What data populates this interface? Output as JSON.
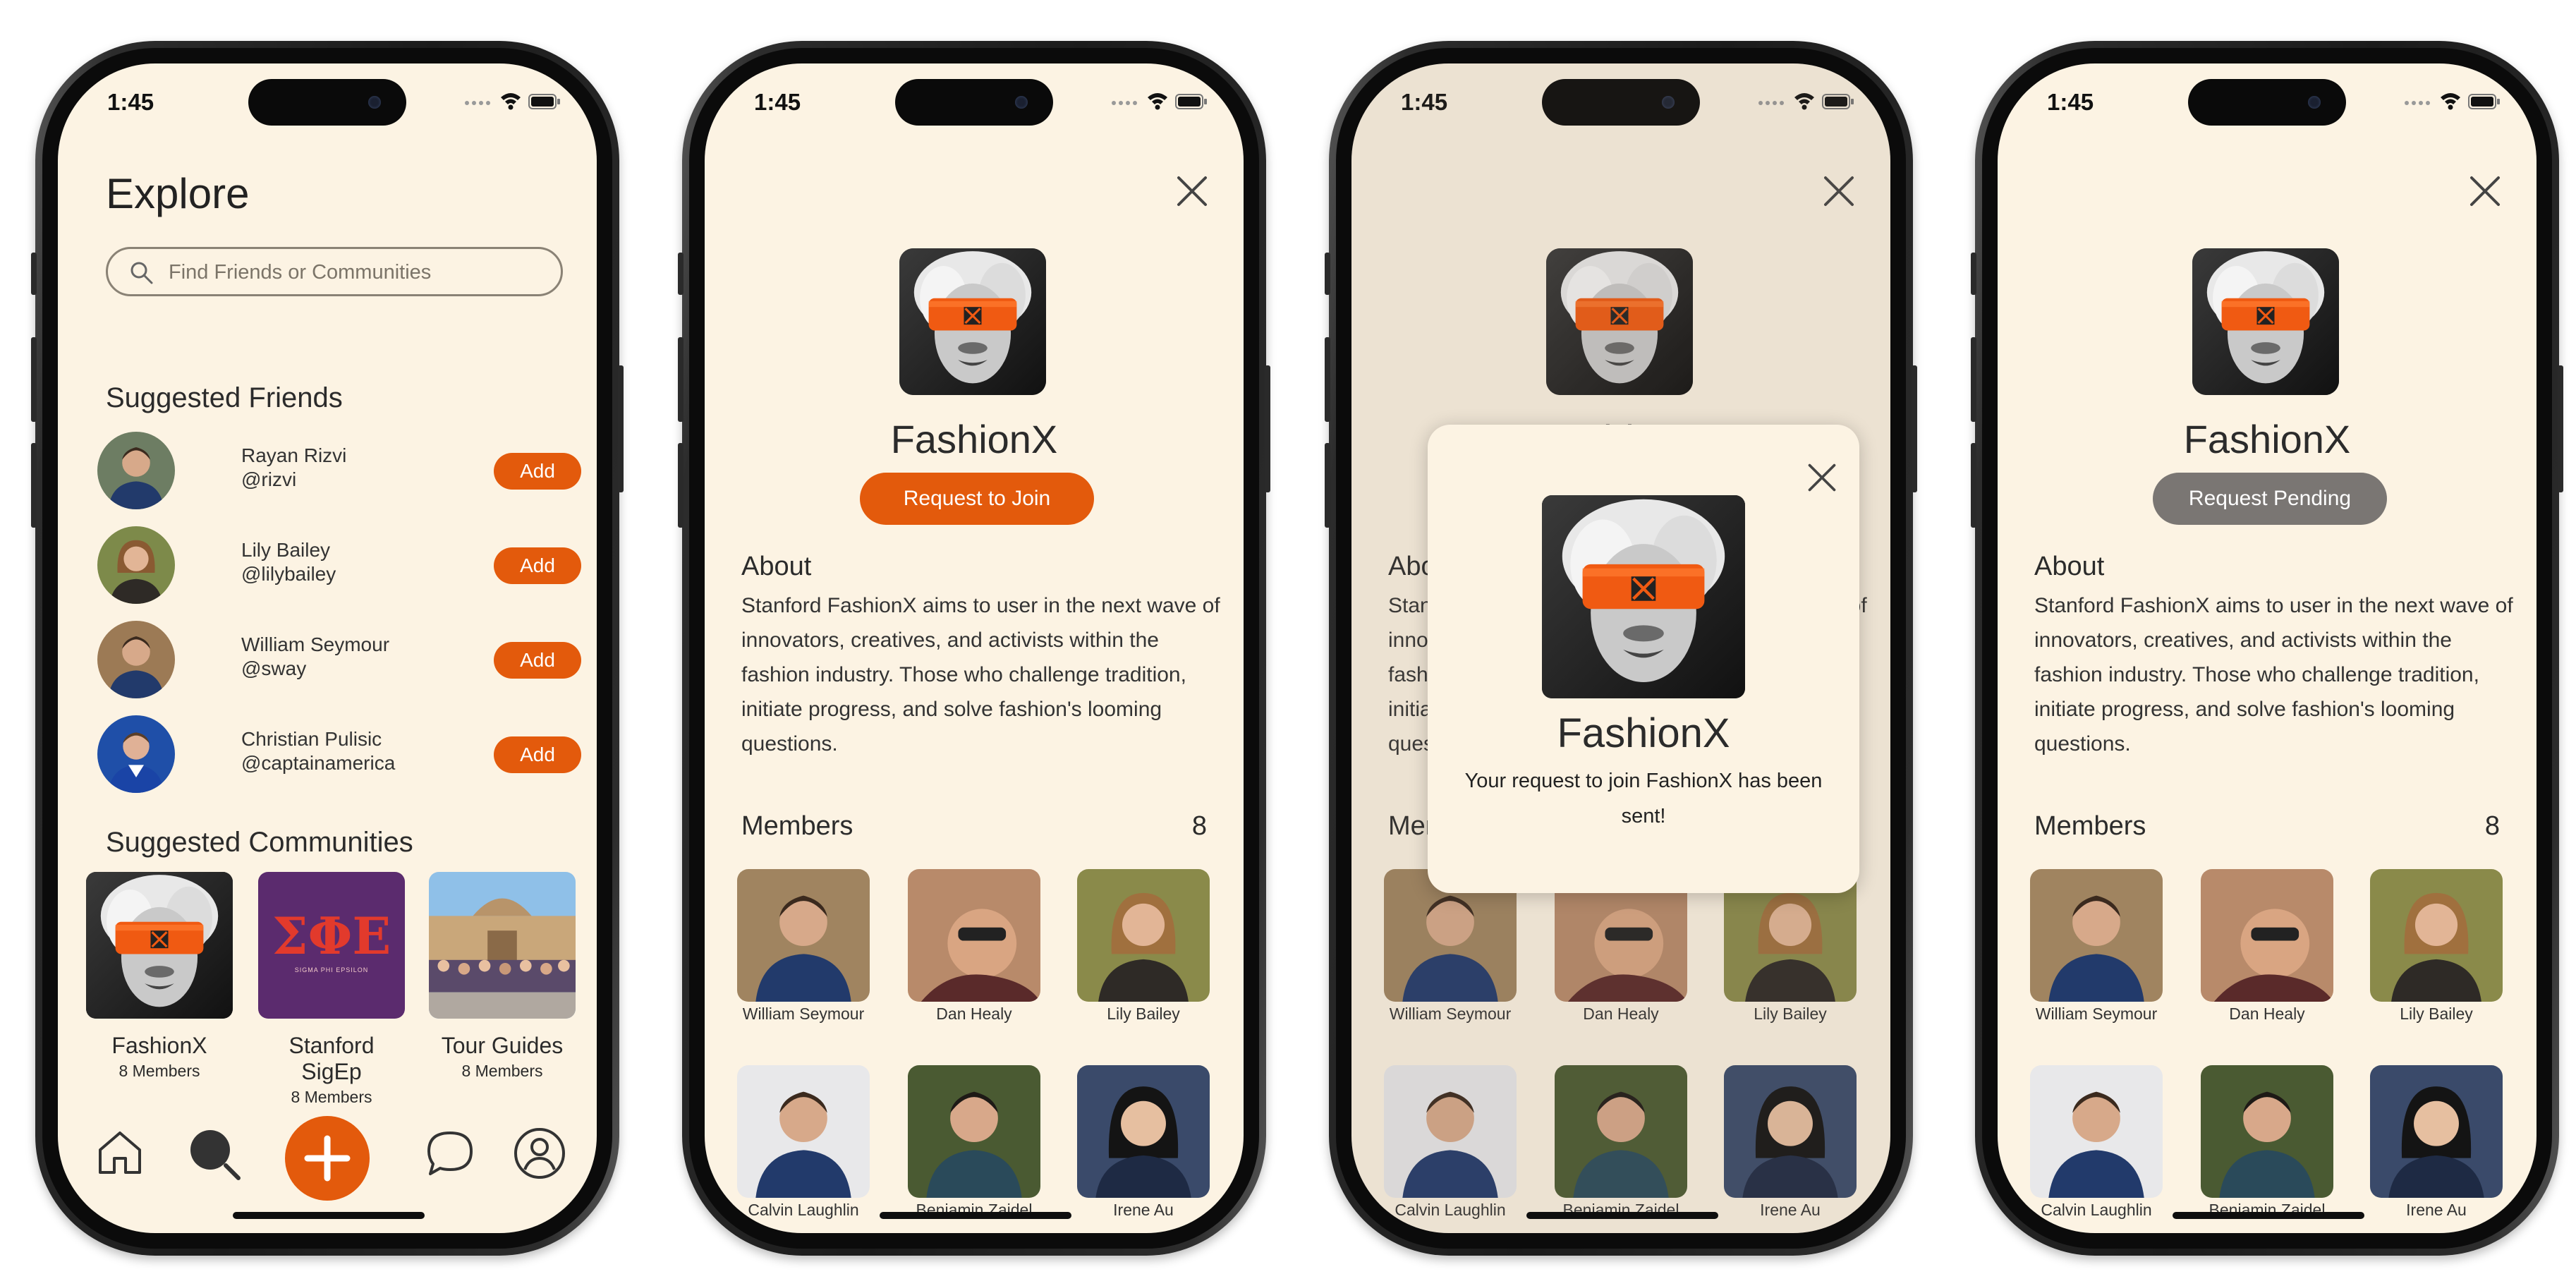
{
  "status": {
    "time": "1:45"
  },
  "explore": {
    "title": "Explore",
    "search_placeholder": "Find Friends or Communities",
    "suggested_friends_title": "Suggested Friends",
    "add_label": "Add",
    "friends": [
      {
        "name": "Rayan Rizvi",
        "handle": "@rizvi"
      },
      {
        "name": "Lily Bailey",
        "handle": "@lilybailey"
      },
      {
        "name": "William Seymour",
        "handle": "@sway"
      },
      {
        "name": "Christian Pulisic",
        "handle": "@captainamerica"
      }
    ],
    "suggested_communities_title": "Suggested Communities",
    "communities": [
      {
        "name": "FashionX",
        "members": "8 Members"
      },
      {
        "name": "Stanford SigEp",
        "members": "8 Members",
        "logo_text": "ΣΦΕ",
        "logo_sub": "SIGMA PHI EPSILON"
      },
      {
        "name": "Tour Guides",
        "members": "8 Members"
      }
    ]
  },
  "community": {
    "name": "FashionX",
    "request_label": "Request to Join",
    "pending_label": "Request Pending",
    "about_title": "About",
    "about_text": "Stanford FashionX aims to user in the next wave of innovators, creatives, and activists within the fashion industry. Those who challenge tradition, initiate progress, and solve fashion's looming questions.",
    "members_title": "Members",
    "members_count": "8",
    "members": [
      "William Seymour",
      "Dan Healy",
      "Lily Bailey",
      "Calvin Laughlin",
      "Benjamin Zaidel",
      "Irene Au"
    ]
  },
  "modal": {
    "title": "FashionX",
    "message": "Your request to join FashionX has been sent!"
  },
  "colors": {
    "accent": "#e35a0c",
    "pending": "#7a7673",
    "background": "#fcf3e3"
  }
}
